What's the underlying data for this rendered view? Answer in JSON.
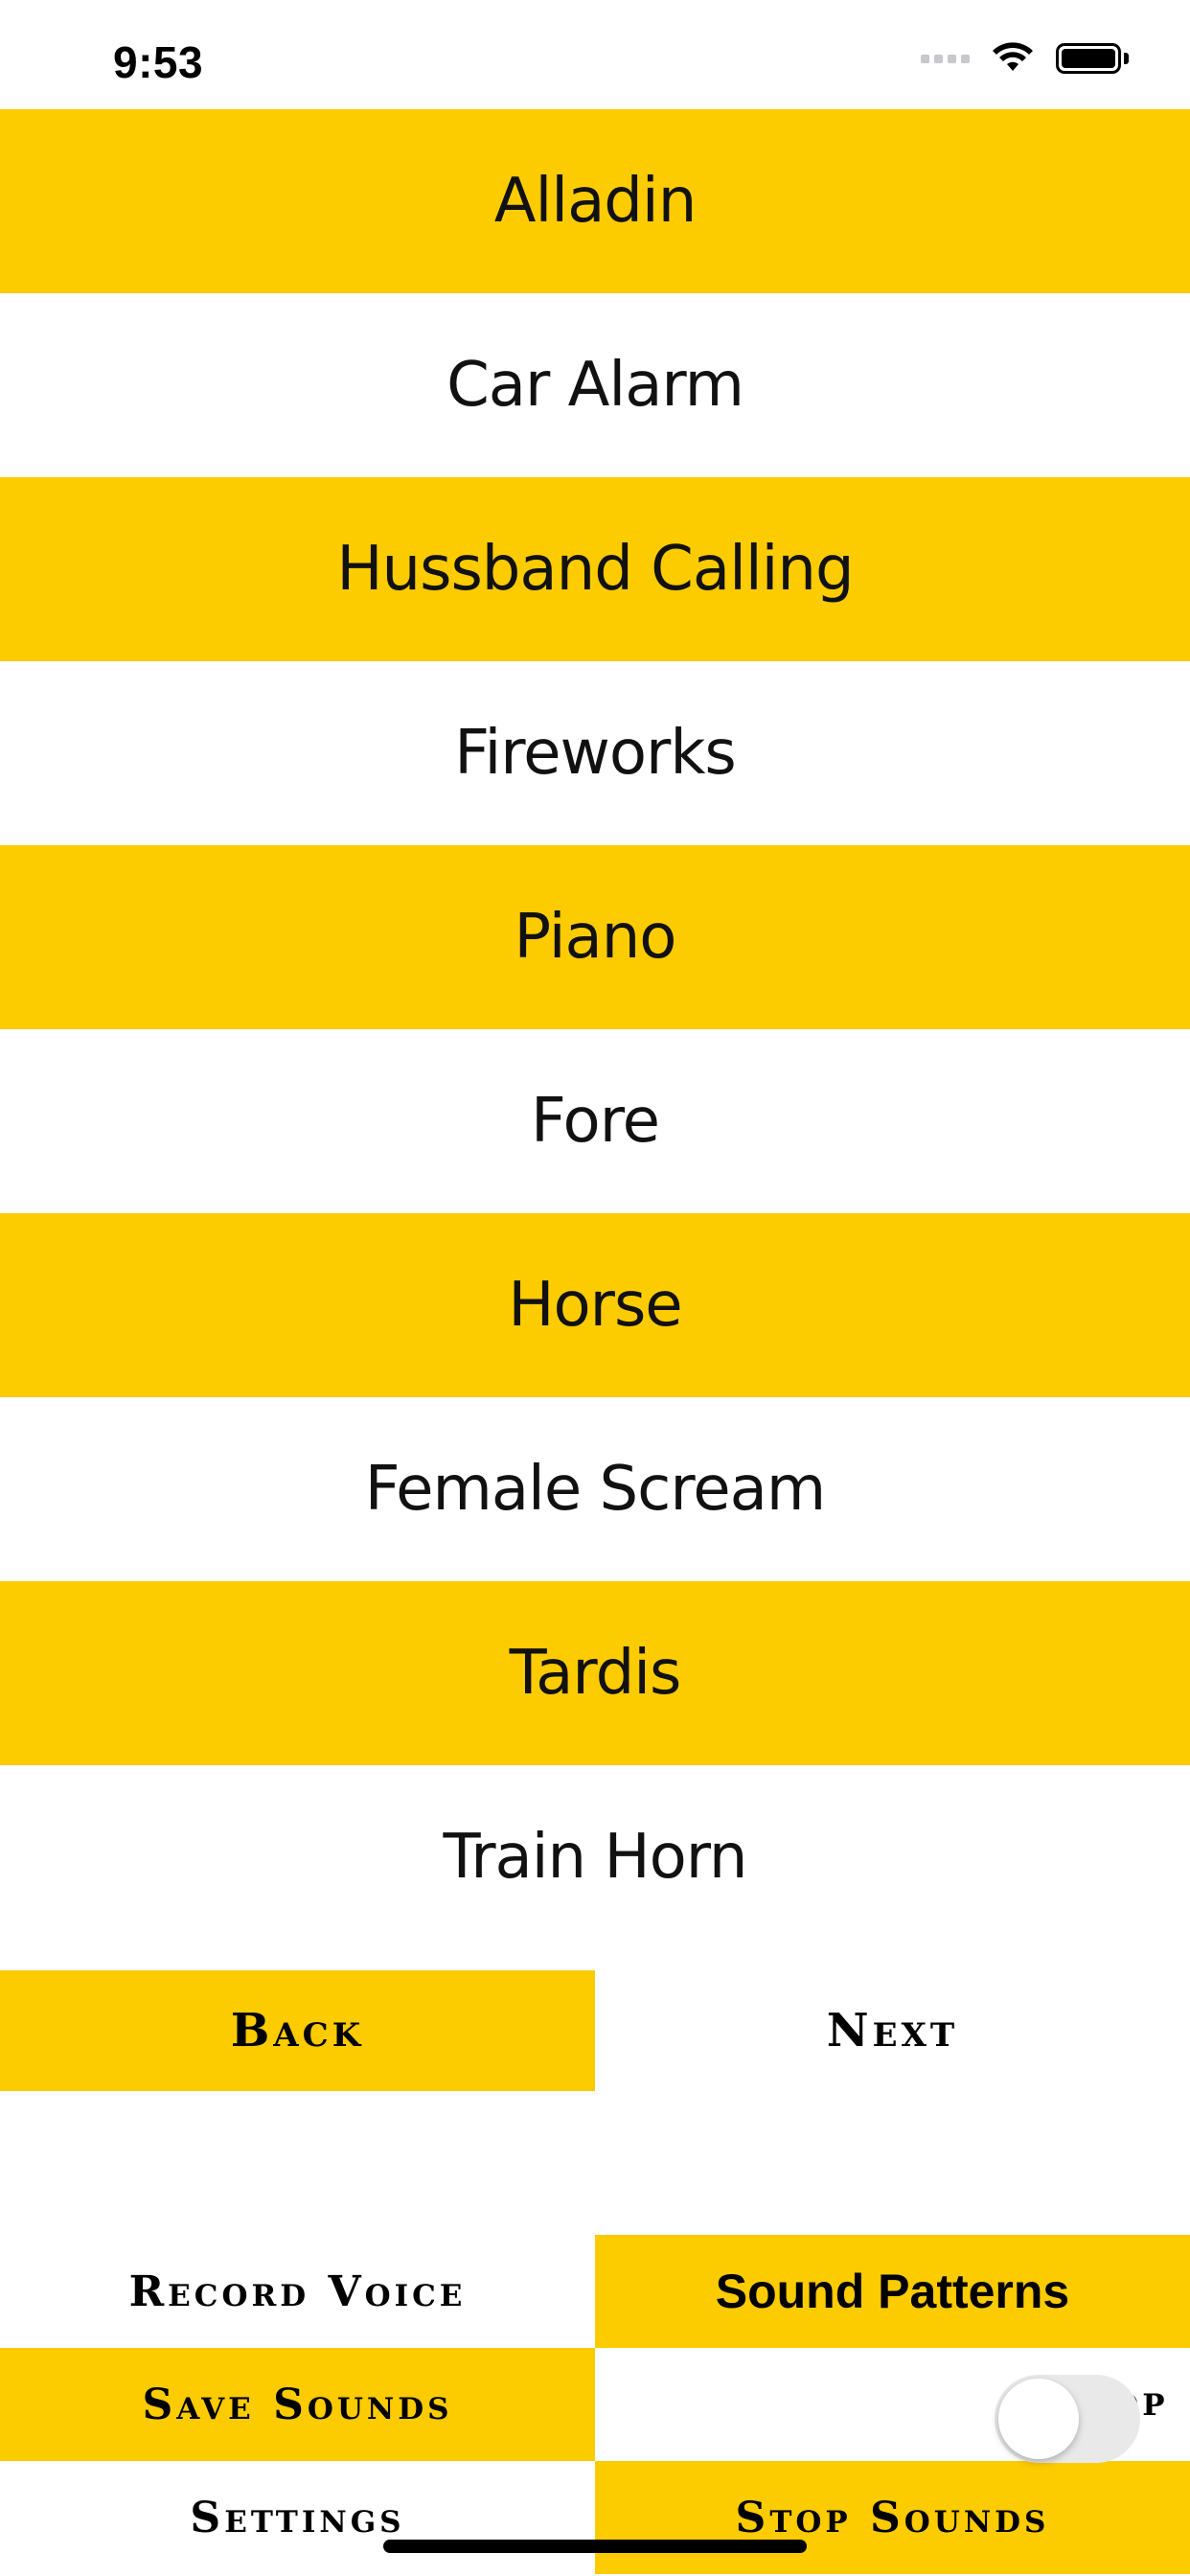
{
  "status_bar": {
    "time": "9:53",
    "icons": [
      "cellular-signal-icon",
      "wifi-icon",
      "battery-icon"
    ]
  },
  "sounds": [
    {
      "label": "Alladin"
    },
    {
      "label": "Car Alarm"
    },
    {
      "label": "Hussband Calling"
    },
    {
      "label": "Fireworks"
    },
    {
      "label": "Piano"
    },
    {
      "label": "Fore"
    },
    {
      "label": "Horse"
    },
    {
      "label": "Female Scream"
    },
    {
      "label": "Tardis"
    },
    {
      "label": "Train Horn"
    }
  ],
  "pager": {
    "back_label": "Back",
    "next_label": "Next"
  },
  "controls": {
    "record_voice_label": "Record Voice",
    "sound_patterns_label": "Sound Patterns",
    "save_sounds_label": "Save Sounds",
    "loop_label": "Loop",
    "loop_enabled": false,
    "settings_label": "Settings",
    "stop_sounds_label": "Stop Sounds"
  },
  "colors": {
    "accent_yellow": "#fccb00",
    "background": "#ffffff",
    "text": "#000000",
    "toggle_off": "#e9e9ea"
  }
}
